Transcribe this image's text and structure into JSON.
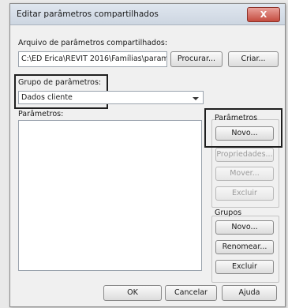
{
  "window": {
    "title": "Editar parâmetros compartilhados",
    "close_label": "X"
  },
  "file": {
    "label": "Arquivo de parâmetros compartilhados:",
    "path": "C:\\ED Erica\\REVIT 2016\\Famílias\\paramet",
    "browse_label": "Procurar...",
    "create_label": "Criar..."
  },
  "group": {
    "label": "Grupo de parâmetros:",
    "selected": "Dados cliente"
  },
  "params_list": {
    "label": "Parâmetros:"
  },
  "parametros": {
    "title": "Parâmetros",
    "new_label": "Novo...",
    "properties_label": "Propriedades...",
    "move_label": "Mover...",
    "delete_label": "Excluir"
  },
  "grupos": {
    "title": "Grupos",
    "new_label": "Novo...",
    "rename_label": "Renomear...",
    "delete_label": "Excluir"
  },
  "footer": {
    "ok_label": "OK",
    "cancel_label": "Cancelar",
    "help_label": "Ajuda"
  }
}
